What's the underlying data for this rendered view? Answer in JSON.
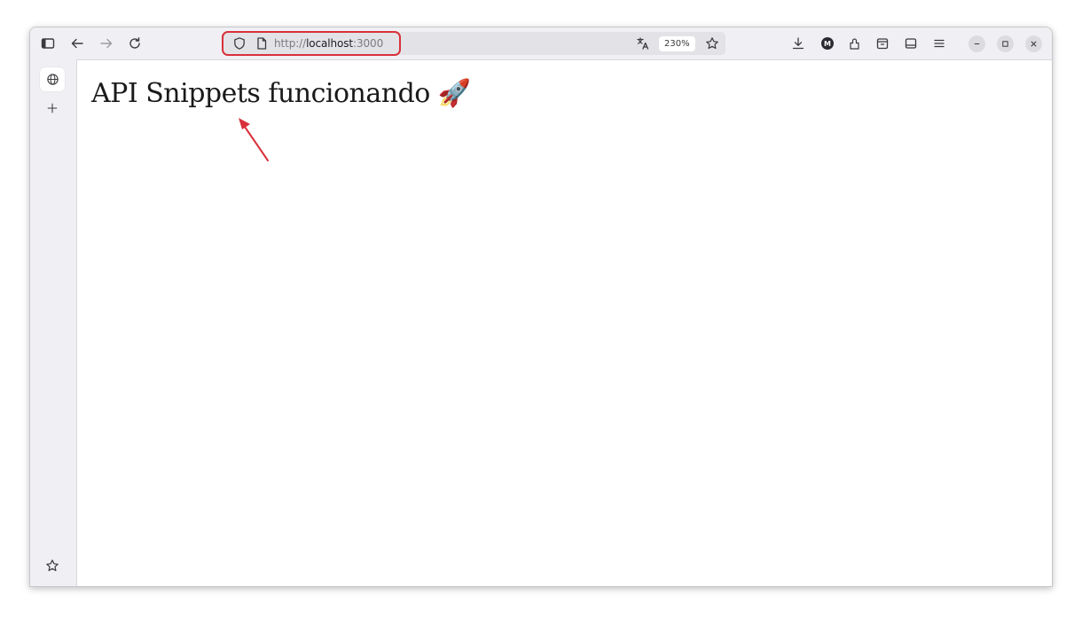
{
  "browser": {
    "url_scheme": "http://",
    "url_host": "localhost",
    "url_port": ":3000",
    "zoom": "230%",
    "account_initial": "M"
  },
  "toolbar_icons": {
    "sidebar_toggle": "sidebar-toggle-icon",
    "back": "back-arrow-icon",
    "forward": "forward-arrow-icon",
    "reload": "reload-icon",
    "shield": "tracking-protection-shield-icon",
    "page": "page-info-icon",
    "translate": "translate-icon",
    "bookmark": "bookmark-star-icon",
    "downloads": "downloads-icon",
    "extensions": "extensions-icon",
    "container": "container-icon",
    "screenshot": "screenshot-icon",
    "menu": "hamburger-menu-icon"
  },
  "sidebar": {
    "icons": [
      "globe-icon",
      "plus-icon",
      "star-icon",
      "gear-icon"
    ]
  },
  "page": {
    "heading": "API Snippets funcionando 🚀"
  },
  "annotations": {
    "highlight_color": "#d8303a"
  }
}
